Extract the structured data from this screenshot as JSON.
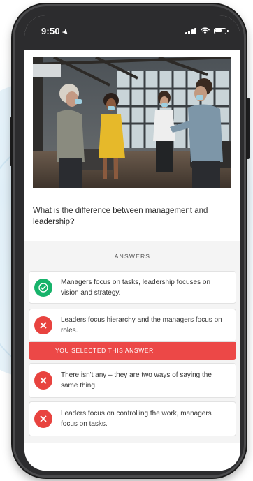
{
  "status_bar": {
    "time": "9:50"
  },
  "question": {
    "text": "What is the difference between management and leadership?"
  },
  "answers_header": "ANSWERS",
  "answers": [
    {
      "text": "Managers focus on tasks, leadership focuses on vision and strategy.",
      "state": "correct",
      "icon": "check-icon"
    },
    {
      "text": "Leaders focus hierarchy and the managers focus on roles.",
      "state": "wrong",
      "icon": "x-icon"
    },
    {
      "text": "There isn't any – they are two ways of saying the same thing.",
      "state": "wrong",
      "icon": "x-icon"
    },
    {
      "text": "Leaders focus on controlling the work, managers focus on tasks.",
      "state": "wrong",
      "icon": "x-icon"
    }
  ],
  "selected_banner": "YOU SELECTED THIS ANSWER",
  "colors": {
    "correct": "#17b36b",
    "wrong": "#e8433f",
    "selected_banner": "#ec4847",
    "phone_frame": "#2c2c2e"
  }
}
